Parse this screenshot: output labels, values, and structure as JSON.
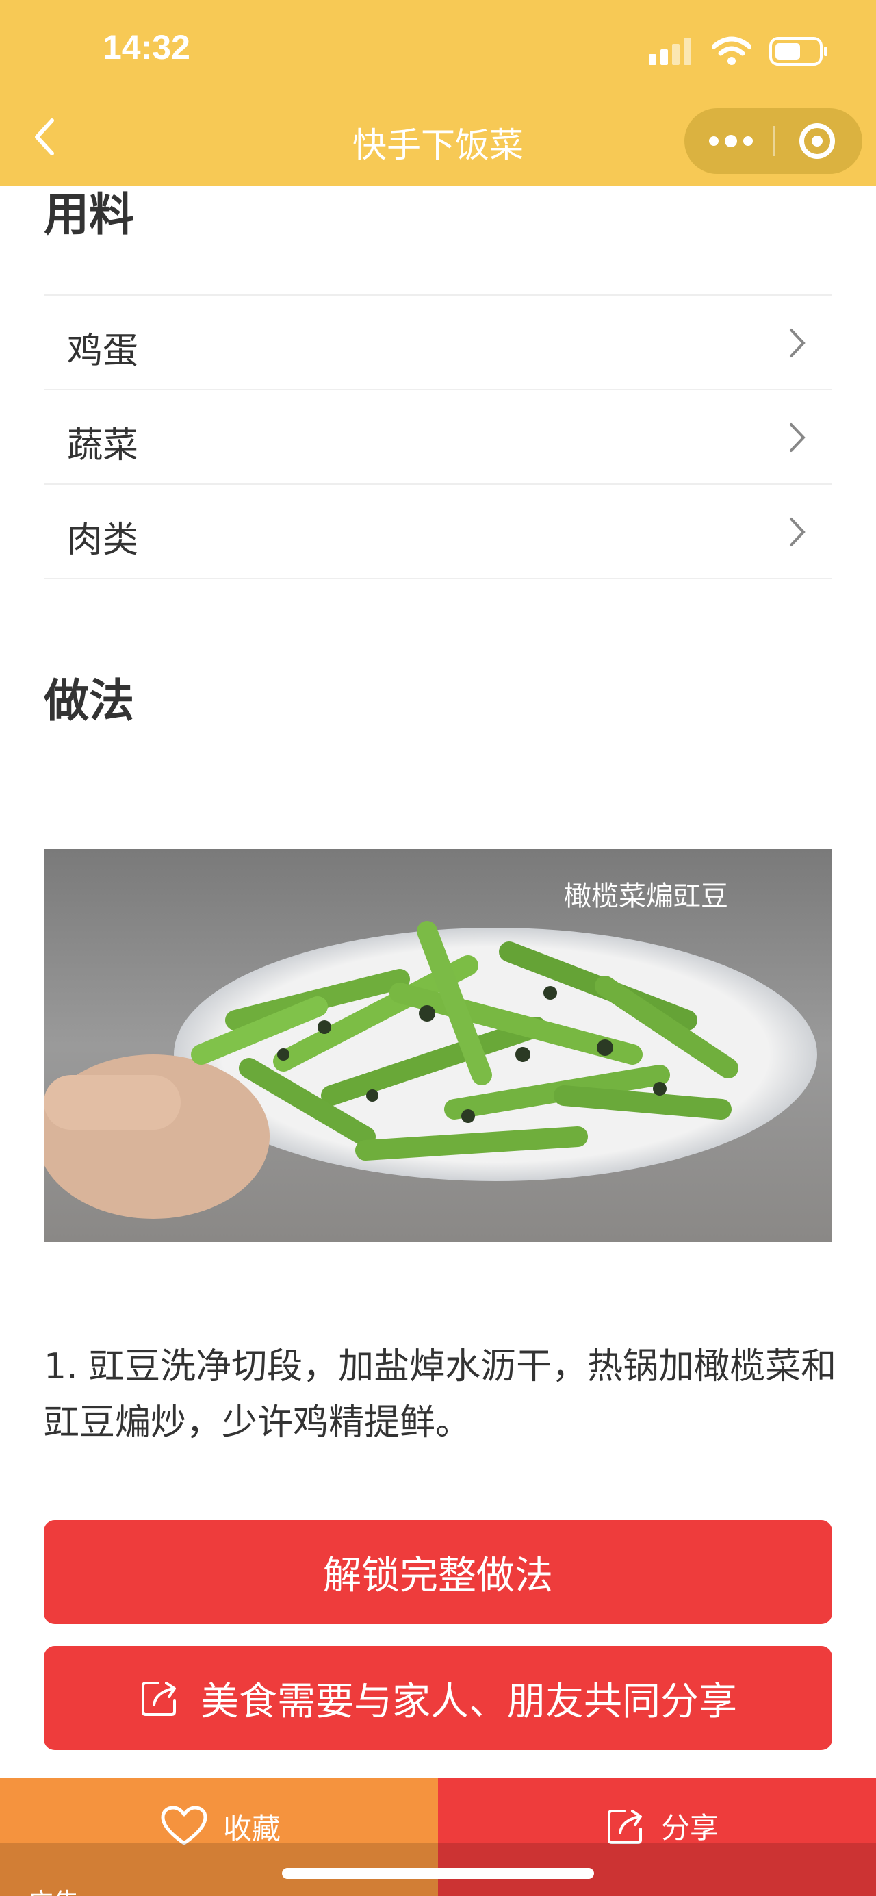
{
  "status": {
    "time": "14:32"
  },
  "nav": {
    "title": "快手下饭菜"
  },
  "ingredients": {
    "title": "用料",
    "items": [
      {
        "label": "鸡蛋"
      },
      {
        "label": "蔬菜"
      },
      {
        "label": "肉类"
      }
    ]
  },
  "method": {
    "title": "做法",
    "photo_caption": "橄榄菜煸豇豆",
    "step_text": "1. 豇豆洗净切段，加盐焯水沥干，热锅加橄榄菜和豇豆煸炒，少许鸡精提鲜。"
  },
  "buttons": {
    "unlock": "解锁完整做法",
    "share_family": "美食需要与家人、朋友共同分享"
  },
  "bottom_bar": {
    "favorite": "收藏",
    "share": "分享",
    "ad": "广告"
  },
  "colors": {
    "nav_bg": "#f7c955",
    "primary_red": "#ee3c3c",
    "favorite_orange": "#f5933e"
  }
}
